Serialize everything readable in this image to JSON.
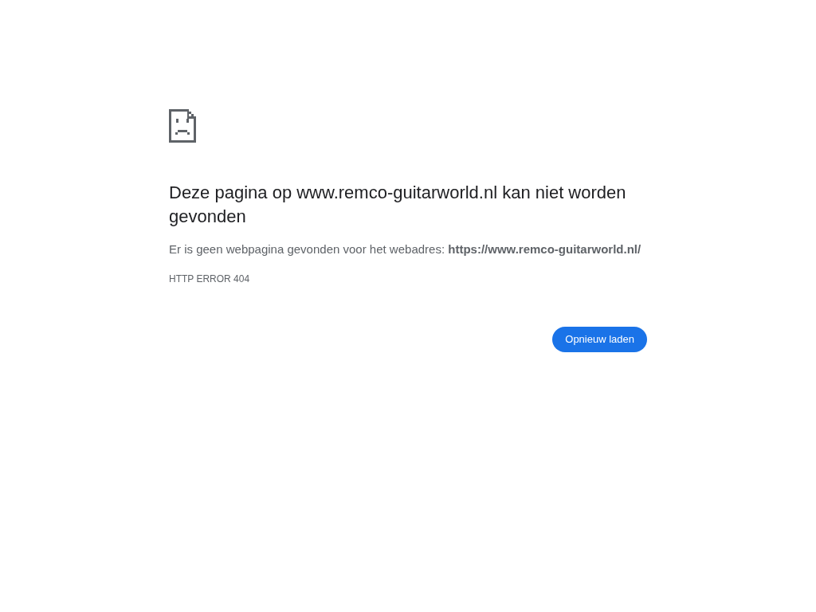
{
  "heading": "Deze pagina op www.remco-guitarworld.nl kan niet worden gevonden",
  "description": "Er is geen webpagina gevonden voor het webadres: **https://www.remco-guitarworld.nl/**",
  "error_code": "HTTP ERROR 404",
  "buttons": [
    {
      "label": "Opnieuw laden",
      "kind": "primary"
    }
  ]
}
